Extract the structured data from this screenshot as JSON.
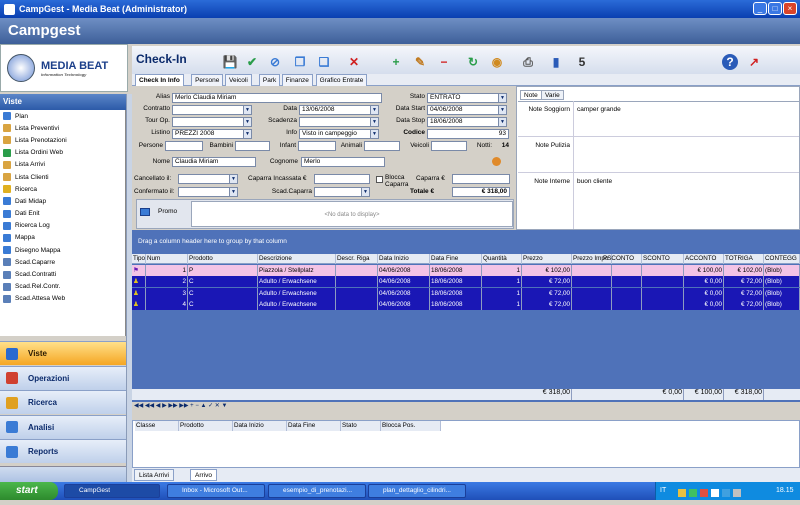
{
  "window": {
    "title": "CampGest - Media Beat (Administrator)",
    "app_header": "Campgest"
  },
  "logo": {
    "name": "MEDIA BEAT",
    "tagline": "Information Technology"
  },
  "sidebar": {
    "header": "Viste",
    "items": [
      {
        "label": "Plan",
        "color": "#3a7bd5"
      },
      {
        "label": "Lista Preventivi",
        "color": "#d9a441"
      },
      {
        "label": "Lista Prenotazioni",
        "color": "#d9a441"
      },
      {
        "label": "Lista Ordini Web",
        "color": "#2a9d4a"
      },
      {
        "label": "Lista Arrivi",
        "color": "#d9a441"
      },
      {
        "label": "Lista Clienti",
        "color": "#d9a441"
      },
      {
        "label": "Ricerca",
        "color": "#e0b020"
      },
      {
        "label": "Dati Midap",
        "color": "#3a7bd5"
      },
      {
        "label": "Dati Enit",
        "color": "#3a7bd5"
      },
      {
        "label": "Ricerca Log",
        "color": "#3a7bd5"
      },
      {
        "label": "Mappa",
        "color": "#3a7bd5"
      },
      {
        "label": "Disegno Mappa",
        "color": "#3a7bd5"
      },
      {
        "label": "Scad.Caparre",
        "color": "#5a7fb8"
      },
      {
        "label": "Scad.Contratti",
        "color": "#5a7fb8"
      },
      {
        "label": "Scad.Rel.Contr.",
        "color": "#5a7fb8"
      },
      {
        "label": "Scad.Attesa Web",
        "color": "#5a7fb8"
      }
    ],
    "sections": [
      {
        "label": "Viste",
        "active": true
      },
      {
        "label": "Operazioni",
        "active": false
      },
      {
        "label": "Ricerca",
        "active": false
      },
      {
        "label": "Analisi",
        "active": false
      },
      {
        "label": "Reports",
        "active": false
      }
    ]
  },
  "main": {
    "title": "Check-In",
    "toolbar_icons": [
      "save-icon",
      "confirm-icon",
      "attach-icon",
      "copy-icon",
      "duplicate-icon",
      "delete-icon",
      "add-icon",
      "edit-icon",
      "remove-icon",
      "refresh-icon",
      "palette-icon",
      "print-icon",
      "book-icon",
      "calendar-icon",
      "help-icon",
      "export-icon"
    ],
    "tabs": [
      "Check In Info",
      "Persone",
      "Veicoli",
      "Park",
      "Finanze",
      "Grafico Entrate"
    ]
  },
  "form": {
    "alias_label": "Alias",
    "alias": "Merlo Claudia Miriam",
    "stato_label": "Stato",
    "stato": "ENTRATO",
    "contratto_label": "Contratto",
    "contratto": "",
    "data_label": "Data",
    "data": "13/06/2008",
    "data_start_label": "Data Start",
    "data_start": "04/06/2008",
    "tour_label": "Tour Op.",
    "tour": "",
    "scadenza_label": "Scadenza",
    "scadenza": "",
    "data_stop_label": "Data Stop",
    "data_stop": "18/06/2008",
    "listino_label": "Listino",
    "listino": "PREZZI 2008",
    "info_label": "Info",
    "info": "Visto in campeggio",
    "codice_label": "Codice",
    "codice": "93",
    "persone_label": "Persone",
    "bambini_label": "Bambini",
    "infant_label": "Infant",
    "animali_label": "Animali",
    "veicoli_label": "Veicoli",
    "notti_label": "Notti:",
    "notti": "14",
    "nome_label": "Nome",
    "nome": "Claudia Miriam",
    "cognome_label": "Cognome",
    "cognome": "Merlo",
    "cancellato_label": "Cancellato il:",
    "caparra_inc_label": "Caparra Incassata €",
    "blocca_label": "Blocca Caparra",
    "caparra_label": "Caparra €",
    "confermato_label": "Confermato il:",
    "scad_caparra_label": "Scad.Caparra",
    "totale_label": "Totale €",
    "totale": "€ 318,00",
    "promo_label": "Promo",
    "promo_empty": "<No data to display>"
  },
  "notes": {
    "tabs": [
      "Note",
      "Varie"
    ],
    "soggiorno_label": "Note Soggiorn",
    "soggiorno": "camper grande",
    "pulizia_label": "Note Pulizia",
    "pulizia": "",
    "interne_label": "Note Interne",
    "interne": "buon cliente"
  },
  "grid": {
    "group_hint": "Drag a column header here to group by that column",
    "columns": [
      "Tipo",
      "Num",
      "Prodotto",
      "Descrizione",
      "Descr. Riga",
      "Data Inizio",
      "Data Fine",
      "Quantità",
      "Prezzo",
      "Prezzo Impo",
      "PSCONTO",
      "SCONTO",
      "ACCONTO",
      "TOTRIGA",
      "CONTEGG"
    ],
    "rows": [
      {
        "tipo": "flag",
        "num": "1",
        "prodotto": "P",
        "descrizione": "Piazzola / Stellplatz",
        "riga": "",
        "inizio": "04/06/2008",
        "fine": "18/06/2008",
        "qta": "1",
        "prezzo": "€ 102,00",
        "impo": "",
        "psconto": "",
        "sconto": "",
        "acconto": "€ 100,00",
        "totriga": "€ 102,00",
        "contegg": "(Blob)",
        "style": "pink"
      },
      {
        "tipo": "person",
        "num": "2",
        "prodotto": "C",
        "descrizione": "Adulto / Erwachsene",
        "riga": "",
        "inizio": "04/06/2008",
        "fine": "18/06/2008",
        "qta": "1",
        "prezzo": "€ 72,00",
        "impo": "",
        "psconto": "",
        "sconto": "",
        "acconto": "€ 0,00",
        "totriga": "€ 72,00",
        "contegg": "(Blob)",
        "style": "blue"
      },
      {
        "tipo": "person",
        "num": "3",
        "prodotto": "C",
        "descrizione": "Adulto / Erwachsene",
        "riga": "",
        "inizio": "04/06/2008",
        "fine": "18/06/2008",
        "qta": "1",
        "prezzo": "€ 72,00",
        "impo": "",
        "psconto": "",
        "sconto": "",
        "acconto": "€ 0,00",
        "totriga": "€ 72,00",
        "contegg": "(Blob)",
        "style": "blue"
      },
      {
        "tipo": "person",
        "num": "4",
        "prodotto": "C",
        "descrizione": "Adulto / Erwachsene",
        "riga": "",
        "inizio": "04/06/2008",
        "fine": "18/06/2008",
        "qta": "1",
        "prezzo": "€ 72,00",
        "impo": "",
        "psconto": "",
        "sconto": "",
        "acconto": "€ 0,00",
        "totriga": "€ 72,00",
        "contegg": "(Blob)",
        "style": "blue"
      }
    ],
    "totals": {
      "prezzo": "€ 318,00",
      "sconto": "€ 0,00",
      "acconto": "€ 100,00",
      "totriga": "€ 318,00"
    }
  },
  "bottom_grid": {
    "columns": [
      "Classe",
      "Prodotto",
      "Data Inizio",
      "Data Fine",
      "Stato",
      "Blocca Pos."
    ]
  },
  "bottom_tabs": [
    "Lista Arrivi",
    "Arrivo"
  ],
  "taskbar": {
    "start": "start",
    "tasks": [
      "CampGest",
      "Inbox - Microsoft Out...",
      "esempio_di_prenotazi...",
      "plan_dettaglio_cilindri..."
    ],
    "lang": "IT",
    "clock": "18.15"
  }
}
